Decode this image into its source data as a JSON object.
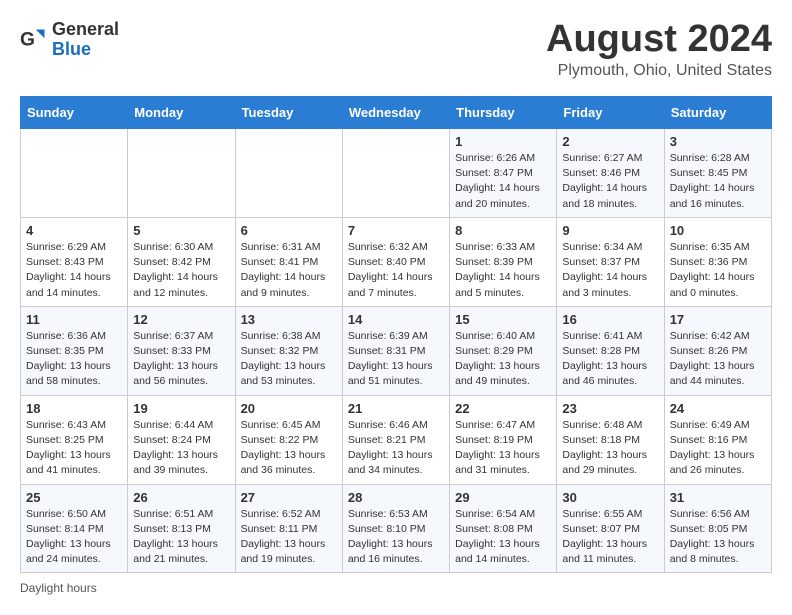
{
  "header": {
    "logo_general": "General",
    "logo_blue": "Blue",
    "month_year": "August 2024",
    "location": "Plymouth, Ohio, United States"
  },
  "footer": {
    "daylight_label": "Daylight hours"
  },
  "weekdays": [
    "Sunday",
    "Monday",
    "Tuesday",
    "Wednesday",
    "Thursday",
    "Friday",
    "Saturday"
  ],
  "weeks": [
    [
      {
        "day": "",
        "info": ""
      },
      {
        "day": "",
        "info": ""
      },
      {
        "day": "",
        "info": ""
      },
      {
        "day": "",
        "info": ""
      },
      {
        "day": "1",
        "info": "Sunrise: 6:26 AM\nSunset: 8:47 PM\nDaylight: 14 hours and 20 minutes."
      },
      {
        "day": "2",
        "info": "Sunrise: 6:27 AM\nSunset: 8:46 PM\nDaylight: 14 hours and 18 minutes."
      },
      {
        "day": "3",
        "info": "Sunrise: 6:28 AM\nSunset: 8:45 PM\nDaylight: 14 hours and 16 minutes."
      }
    ],
    [
      {
        "day": "4",
        "info": "Sunrise: 6:29 AM\nSunset: 8:43 PM\nDaylight: 14 hours and 14 minutes."
      },
      {
        "day": "5",
        "info": "Sunrise: 6:30 AM\nSunset: 8:42 PM\nDaylight: 14 hours and 12 minutes."
      },
      {
        "day": "6",
        "info": "Sunrise: 6:31 AM\nSunset: 8:41 PM\nDaylight: 14 hours and 9 minutes."
      },
      {
        "day": "7",
        "info": "Sunrise: 6:32 AM\nSunset: 8:40 PM\nDaylight: 14 hours and 7 minutes."
      },
      {
        "day": "8",
        "info": "Sunrise: 6:33 AM\nSunset: 8:39 PM\nDaylight: 14 hours and 5 minutes."
      },
      {
        "day": "9",
        "info": "Sunrise: 6:34 AM\nSunset: 8:37 PM\nDaylight: 14 hours and 3 minutes."
      },
      {
        "day": "10",
        "info": "Sunrise: 6:35 AM\nSunset: 8:36 PM\nDaylight: 14 hours and 0 minutes."
      }
    ],
    [
      {
        "day": "11",
        "info": "Sunrise: 6:36 AM\nSunset: 8:35 PM\nDaylight: 13 hours and 58 minutes."
      },
      {
        "day": "12",
        "info": "Sunrise: 6:37 AM\nSunset: 8:33 PM\nDaylight: 13 hours and 56 minutes."
      },
      {
        "day": "13",
        "info": "Sunrise: 6:38 AM\nSunset: 8:32 PM\nDaylight: 13 hours and 53 minutes."
      },
      {
        "day": "14",
        "info": "Sunrise: 6:39 AM\nSunset: 8:31 PM\nDaylight: 13 hours and 51 minutes."
      },
      {
        "day": "15",
        "info": "Sunrise: 6:40 AM\nSunset: 8:29 PM\nDaylight: 13 hours and 49 minutes."
      },
      {
        "day": "16",
        "info": "Sunrise: 6:41 AM\nSunset: 8:28 PM\nDaylight: 13 hours and 46 minutes."
      },
      {
        "day": "17",
        "info": "Sunrise: 6:42 AM\nSunset: 8:26 PM\nDaylight: 13 hours and 44 minutes."
      }
    ],
    [
      {
        "day": "18",
        "info": "Sunrise: 6:43 AM\nSunset: 8:25 PM\nDaylight: 13 hours and 41 minutes."
      },
      {
        "day": "19",
        "info": "Sunrise: 6:44 AM\nSunset: 8:24 PM\nDaylight: 13 hours and 39 minutes."
      },
      {
        "day": "20",
        "info": "Sunrise: 6:45 AM\nSunset: 8:22 PM\nDaylight: 13 hours and 36 minutes."
      },
      {
        "day": "21",
        "info": "Sunrise: 6:46 AM\nSunset: 8:21 PM\nDaylight: 13 hours and 34 minutes."
      },
      {
        "day": "22",
        "info": "Sunrise: 6:47 AM\nSunset: 8:19 PM\nDaylight: 13 hours and 31 minutes."
      },
      {
        "day": "23",
        "info": "Sunrise: 6:48 AM\nSunset: 8:18 PM\nDaylight: 13 hours and 29 minutes."
      },
      {
        "day": "24",
        "info": "Sunrise: 6:49 AM\nSunset: 8:16 PM\nDaylight: 13 hours and 26 minutes."
      }
    ],
    [
      {
        "day": "25",
        "info": "Sunrise: 6:50 AM\nSunset: 8:14 PM\nDaylight: 13 hours and 24 minutes."
      },
      {
        "day": "26",
        "info": "Sunrise: 6:51 AM\nSunset: 8:13 PM\nDaylight: 13 hours and 21 minutes."
      },
      {
        "day": "27",
        "info": "Sunrise: 6:52 AM\nSunset: 8:11 PM\nDaylight: 13 hours and 19 minutes."
      },
      {
        "day": "28",
        "info": "Sunrise: 6:53 AM\nSunset: 8:10 PM\nDaylight: 13 hours and 16 minutes."
      },
      {
        "day": "29",
        "info": "Sunrise: 6:54 AM\nSunset: 8:08 PM\nDaylight: 13 hours and 14 minutes."
      },
      {
        "day": "30",
        "info": "Sunrise: 6:55 AM\nSunset: 8:07 PM\nDaylight: 13 hours and 11 minutes."
      },
      {
        "day": "31",
        "info": "Sunrise: 6:56 AM\nSunset: 8:05 PM\nDaylight: 13 hours and 8 minutes."
      }
    ]
  ]
}
